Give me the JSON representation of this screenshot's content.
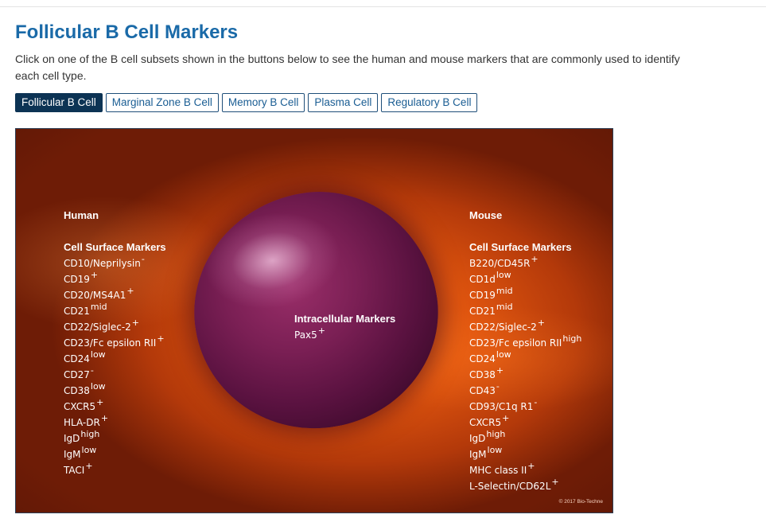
{
  "page": {
    "title": "Follicular B Cell Markers",
    "intro": "Click on one of the B cell subsets shown in the buttons below to see the human and mouse markers that are commonly used to identify each cell type."
  },
  "subset_buttons": [
    {
      "label": "Follicular B Cell",
      "active": true
    },
    {
      "label": "Marginal Zone B Cell",
      "active": false
    },
    {
      "label": "Memory B Cell",
      "active": false
    },
    {
      "label": "Plasma Cell",
      "active": false
    },
    {
      "label": "Regulatory B Cell",
      "active": false
    }
  ],
  "figure": {
    "human": {
      "heading": "Human",
      "surface_heading": "Cell Surface Markers",
      "markers": [
        {
          "name": "CD10/Neprilysin",
          "level": "-"
        },
        {
          "name": "CD19",
          "level": "+"
        },
        {
          "name": "CD20/MS4A1",
          "level": "+"
        },
        {
          "name": "CD21",
          "level": "mid"
        },
        {
          "name": "CD22/Siglec-2",
          "level": "+"
        },
        {
          "name": "CD23/Fc epsilon RII",
          "level": "+"
        },
        {
          "name": "CD24",
          "level": "low"
        },
        {
          "name": "CD27",
          "level": "-"
        },
        {
          "name": "CD38",
          "level": "low"
        },
        {
          "name": "CXCR5",
          "level": "+"
        },
        {
          "name": "HLA-DR",
          "level": "+"
        },
        {
          "name": "IgD",
          "level": "high"
        },
        {
          "name": "IgM",
          "level": "low"
        },
        {
          "name": "TACI",
          "level": "+"
        }
      ]
    },
    "intracellular": {
      "heading": "Intracellular Markers",
      "markers": [
        {
          "name": "Pax5",
          "level": "+"
        }
      ]
    },
    "mouse": {
      "heading": "Mouse",
      "surface_heading": "Cell Surface Markers",
      "markers": [
        {
          "name": "B220/CD45R",
          "level": "+"
        },
        {
          "name": "CD1d",
          "level": "low"
        },
        {
          "name": "CD19",
          "level": "mid"
        },
        {
          "name": "CD21",
          "level": "mid"
        },
        {
          "name": "CD22/Siglec-2",
          "level": "+"
        },
        {
          "name": "CD23/Fc epsilon RII",
          "level": "high"
        },
        {
          "name": "CD24",
          "level": "low"
        },
        {
          "name": "CD38",
          "level": "+"
        },
        {
          "name": "CD43",
          "level": "-"
        },
        {
          "name": "CD93/C1q R1",
          "level": "-"
        },
        {
          "name": "CXCR5",
          "level": "+"
        },
        {
          "name": "IgD",
          "level": "high"
        },
        {
          "name": "IgM",
          "level": "low"
        },
        {
          "name": "MHC class II",
          "level": "+"
        },
        {
          "name": "L-Selectin/CD62L",
          "level": "+"
        }
      ]
    },
    "copyright": "© 2017 Bio-Techne"
  },
  "colors": {
    "title": "#1a6aa8",
    "button_active_bg": "#0c3354",
    "button_border": "#1f4f7a",
    "cell_purple": "#7a1f54",
    "background_orange": "#e0550f"
  }
}
